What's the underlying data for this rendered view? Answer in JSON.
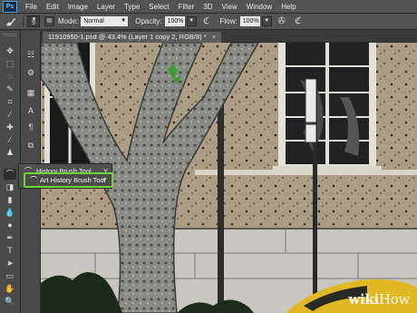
{
  "app": {
    "logo": "Ps"
  },
  "menu": [
    "File",
    "Edit",
    "Image",
    "Layer",
    "Type",
    "Select",
    "Filter",
    "3D",
    "View",
    "Window",
    "Help"
  ],
  "options": {
    "brush_size": "9",
    "mode_label": "Mode:",
    "mode_value": "Normal",
    "opacity_label": "Opacity:",
    "opacity_value": "100%",
    "flow_label": "Flow:",
    "flow_value": "100%"
  },
  "document": {
    "tab_title": "11910950-1.psd @ 43.4% (Layer 1 copy 2, RGB/8) *",
    "close": "×"
  },
  "flyout": {
    "items": [
      {
        "label": "History Brush Tool",
        "shortcut": "Y"
      },
      {
        "label": "Art History Brush Tool",
        "shortcut": "Y"
      }
    ]
  },
  "watermark": {
    "bold": "wiki",
    "light": "How"
  },
  "colors": {
    "highlight": "#6dd53a",
    "panel": "#535353",
    "toolbar": "#4a4a4a"
  }
}
